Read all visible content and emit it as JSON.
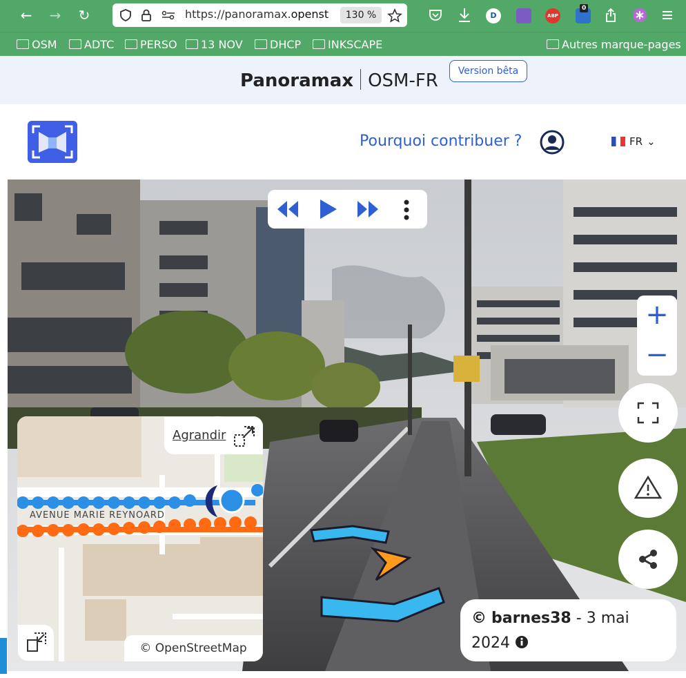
{
  "browser": {
    "url_prefix": "https://panoramax.",
    "url_domain": "openst",
    "zoom_level": "130 %",
    "bookmarks": [
      "OSM",
      "ADTC",
      "PERSO",
      "13 NOV",
      "DHCP",
      "INKSCAPE"
    ],
    "other_bookmarks": "Autres marque-pages",
    "extensions": {
      "d_badge": "D",
      "abp_badge": "ABP",
      "counter_badge": "0"
    }
  },
  "site": {
    "brand": "Panoramax",
    "instance": "OSM-FR",
    "beta_label": "Version bêta",
    "why_contribute": "Pourquoi contribuer ?",
    "language": "FR"
  },
  "viewer": {
    "expand_label": "Agrandir",
    "map_road_label": "AVENUE MARIE REYNOARD",
    "osm_attribution": "© OpenStreetMap",
    "author": "barnes38",
    "date": "3 mai 2024",
    "credit_prefix": "©"
  },
  "colors": {
    "browser_green": "#52a866",
    "brand_blue": "#2f5fd0",
    "sequence_blue": "#2c8fe6",
    "sequence_orange": "#ff6a13",
    "arrow_orange": "#ff9a1a",
    "arrow_cyan": "#39b8f0"
  }
}
